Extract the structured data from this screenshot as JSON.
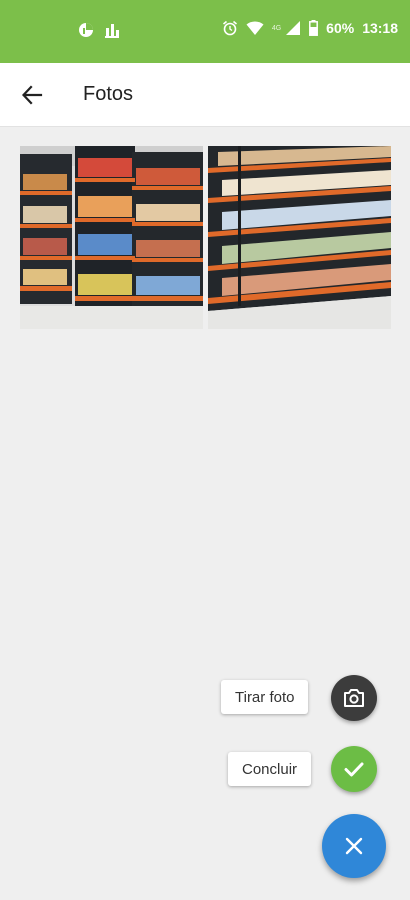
{
  "status_bar": {
    "battery": "60%",
    "time": "13:18",
    "network": "4G",
    "color": "#7cbf4a"
  },
  "app_bar": {
    "title": "Fotos"
  },
  "photos": [
    {
      "name": "store-shelf-photo-1"
    },
    {
      "name": "store-shelf-photo-2"
    }
  ],
  "speed_dial": {
    "take_photo_label": "Tirar foto",
    "finish_label": "Concluir",
    "main_color": "#2f87d8",
    "finish_color": "#6cbd45",
    "camera_color": "#3c3c3c"
  }
}
